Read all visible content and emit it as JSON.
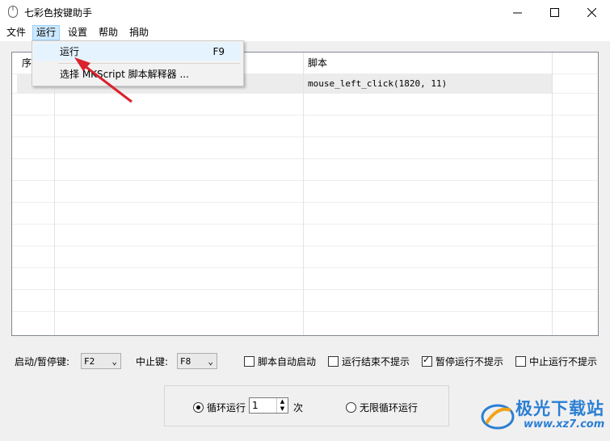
{
  "window": {
    "title": "七彩色按键助手"
  },
  "menubar": [
    {
      "label": "文件"
    },
    {
      "label": "运行"
    },
    {
      "label": "设置"
    },
    {
      "label": "帮助"
    },
    {
      "label": "捐助"
    }
  ],
  "dropdown": {
    "items": [
      {
        "label": "运行",
        "shortcut": "F9"
      },
      {
        "label": "选择 MKScript 脚本解释器 ..."
      }
    ]
  },
  "grid": {
    "col_first": "序",
    "col_script": "脚本",
    "rows": [
      {
        "script": "mouse_left_click(1820, 11)"
      }
    ]
  },
  "hotkeys": {
    "start_label": "启动/暂停键:",
    "start_value": "F2",
    "stop_label": "中止键:",
    "stop_value": "F8"
  },
  "options": [
    {
      "label": "脚本自动启动",
      "checked": false
    },
    {
      "label": "运行结束不提示",
      "checked": false
    },
    {
      "label": "暂停运行不提示",
      "checked": true
    },
    {
      "label": "中止运行不提示",
      "checked": false
    }
  ],
  "loop": {
    "loop_label": "循环运行",
    "loop_count": "1",
    "times_unit": "次",
    "infinite_label": "无限循环运行",
    "selected": "loop"
  },
  "watermark": {
    "text": "极光下载站",
    "url": "www.xz7.com"
  },
  "colors": {
    "menu_active": "#cce8ff",
    "arrow": "#d9232d",
    "watermark": "#2b7fd4"
  }
}
